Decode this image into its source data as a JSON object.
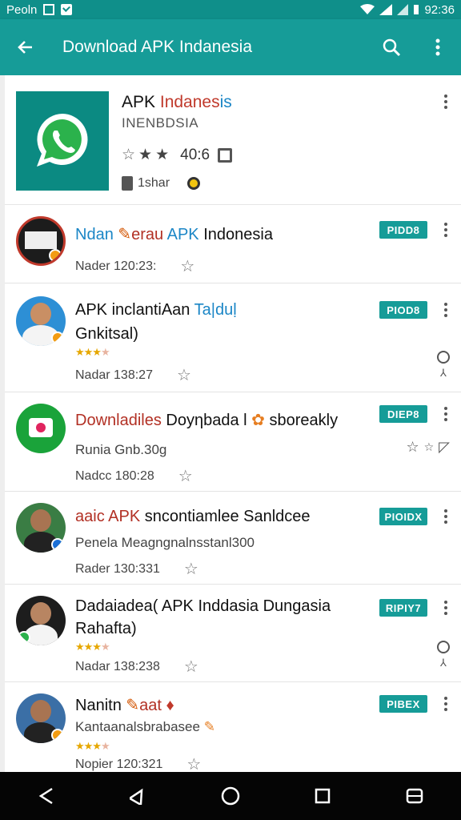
{
  "status_bar": {
    "carrier": "Peoln",
    "time": "92:36"
  },
  "app_bar": {
    "title": "Download APK Indanesia",
    "icons": [
      "back-arrow-icon",
      "search-icon",
      "more-vert-icon"
    ]
  },
  "hero": {
    "name_part1": "APK ",
    "name_part2": "Indanes",
    "name_part3": "is",
    "developer": "INENBDSIA",
    "rating_value": "40:6",
    "stars_filled": 2,
    "size_label": "1shar"
  },
  "items": [
    {
      "title_a": "Ndan ",
      "title_b": "erau ",
      "title_c": "APK",
      "title_d": " Indonesia",
      "subtitle": "",
      "meta": "Nader 120:23:",
      "button": "PIDD8",
      "avatar_color": "#1c1c1c",
      "badge_color": "#f39c12"
    },
    {
      "title_a": "APK inclantiAan ",
      "title_b": "",
      "title_c": "Ta|duḷ",
      "title_d": "",
      "subtitle": "Gnkitsal)",
      "meta": "Nadar 138:27",
      "button": "PIOD8",
      "avatar_color": "#2d8fd5",
      "badge_color": "#f39c12"
    },
    {
      "title_a": "",
      "title_b": "Downladiles",
      "title_c": "",
      "title_d": " Doyηbada l ",
      "title_e": "sboreakly",
      "subtitle": "Runia Gnb.30g",
      "meta": "Nadcc 180:28",
      "button": "DIEP8",
      "avatar_color": "#1aa33a",
      "badge_color": ""
    },
    {
      "title_a": "",
      "title_b": "aaic APK",
      "title_c": "",
      "title_d": " sncontiamlee Sanldcee",
      "subtitle": "Penela Meagngnalnsstanl300",
      "meta": "Rader 130:331",
      "button": "PIOIDX",
      "avatar_color": "#3a7d44",
      "badge_color": "#1b6fd6"
    },
    {
      "title_a": "Dadaiadea( APK Inddasia Dungasia",
      "title_b": "",
      "title_c": "",
      "title_d": "",
      "subtitle": "Rahafta)",
      "meta": "Nadar 138:238",
      "button": "RIPIY7",
      "avatar_color": "#1d1d1d",
      "badge_color": "#2bb24c"
    },
    {
      "title_a": "Nanitn ",
      "title_b": "aat",
      "title_c": "",
      "title_d": "",
      "subtitle": "Kantaanalsbrabasee",
      "meta": "Nopier 120:321",
      "button": "PIBEX",
      "avatar_color": "#3b6fa6",
      "badge_color": "#f39c12"
    }
  ],
  "nav_bar": {
    "icons": [
      "nav-back-icon",
      "nav-back-outline-icon",
      "home-icon",
      "recents-icon",
      "switch-icon"
    ]
  }
}
